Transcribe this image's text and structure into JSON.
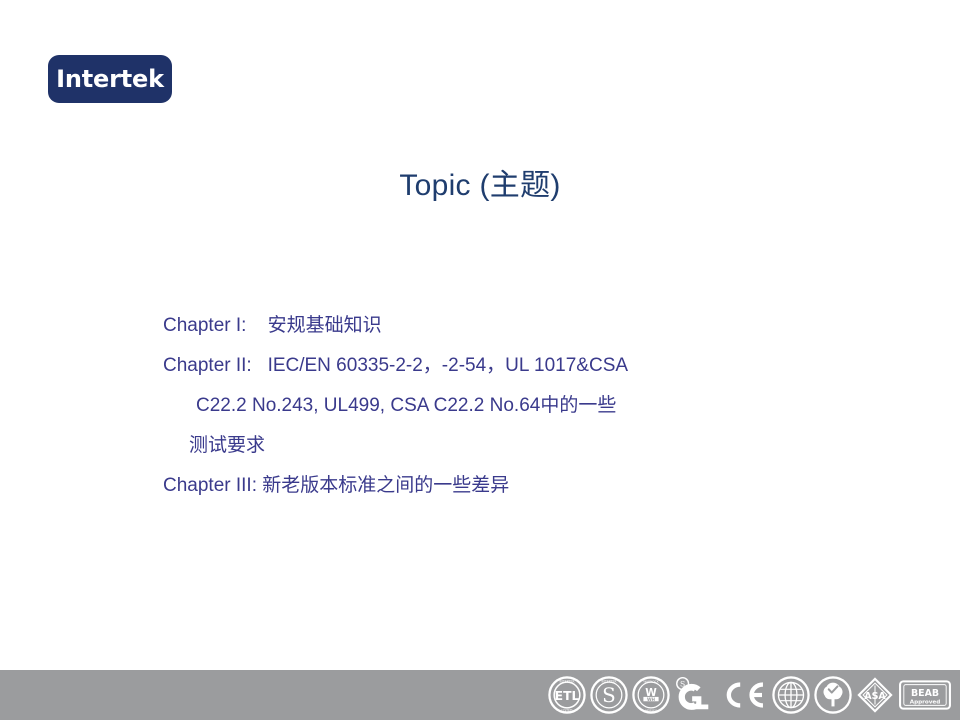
{
  "logo": {
    "text": "Intertek",
    "bg_color": "#1f3268",
    "text_color": "#ffffff"
  },
  "slide": {
    "title": "Topic (主题)",
    "title_color": "#1f3d6e",
    "body_color": "#3a3a8c",
    "background_color": "#ffffff"
  },
  "body_lines": [
    {
      "label": "Chapter I:",
      "text": "安规基础知识"
    },
    {
      "label": "Chapter II:",
      "text": "IEC/EN 60335-2-2，-2-54，UL 1017&CSA"
    },
    {
      "label": "",
      "text": "C22.2 No.243, UL499, CSA C22.2 No.64中的一些"
    },
    {
      "label": "",
      "text": "测试要求"
    },
    {
      "label": "Chapter III:",
      "text": "新老版本标准之间的一些差异"
    }
  ],
  "footer": {
    "bar_color": "#9b9c9e",
    "mark_color": "#ffffff",
    "marks": [
      {
        "name": "etl-mark-icon",
        "label": "ETL"
      },
      {
        "name": "s-mark-icon",
        "label": "S"
      },
      {
        "name": "warnock-hersey-mark-icon",
        "label": "WH"
      },
      {
        "name": "gs-mark-icon",
        "label": "GS"
      },
      {
        "name": "ce-mark-icon",
        "label": "CE"
      },
      {
        "name": "globe-mark-icon",
        "label": "Globe"
      },
      {
        "name": "tree-mark-icon",
        "label": "Tree"
      },
      {
        "name": "asa-diamond-mark-icon",
        "label": "ASA"
      },
      {
        "name": "beab-approved-mark-icon",
        "label": "BEAB Approved"
      }
    ],
    "beab": {
      "line1": "BEAB",
      "line2": "Approved"
    }
  }
}
